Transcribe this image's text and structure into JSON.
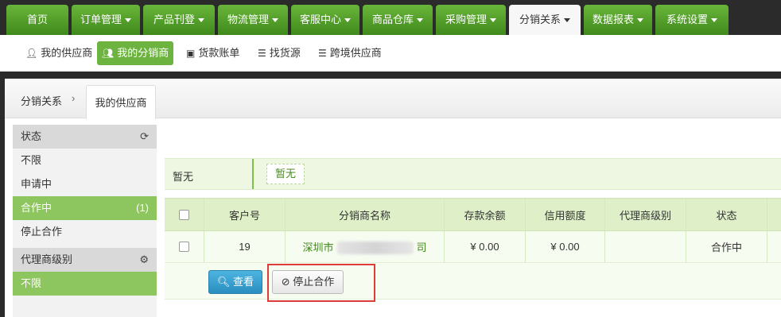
{
  "nav": {
    "tabs": [
      {
        "label": "首页"
      },
      {
        "label": "订单管理"
      },
      {
        "label": "产品刊登"
      },
      {
        "label": "物流管理"
      },
      {
        "label": "客服中心"
      },
      {
        "label": "商品仓库"
      },
      {
        "label": "采购管理"
      },
      {
        "label": "分销关系"
      },
      {
        "label": "数据报表"
      },
      {
        "label": "系统设置"
      }
    ],
    "active": "分销关系"
  },
  "subnav": {
    "items": [
      {
        "label": "我的供应商",
        "icon": "user-icon"
      },
      {
        "label": "我的分销商",
        "icon": "users-icon"
      },
      {
        "label": "货款账单",
        "icon": "money-icon"
      },
      {
        "label": "找货源",
        "icon": "list-icon"
      },
      {
        "label": "跨境供应商",
        "icon": "list-icon"
      }
    ],
    "active": "我的分销商"
  },
  "breadcrumb": {
    "root": "分销关系",
    "sep": "›",
    "current_tab": "我的供应商"
  },
  "filters": {
    "status_title": "状态",
    "status_items": [
      {
        "label": "不限"
      },
      {
        "label": "申请中"
      },
      {
        "label": "合作中",
        "count": "(1)"
      },
      {
        "label": "停止合作"
      }
    ],
    "level_title": "代理商级别",
    "level_items": [
      {
        "label": "不限"
      }
    ]
  },
  "summary": {
    "label": "暂无",
    "tag": "暂无"
  },
  "table": {
    "headers": [
      "客户号",
      "分销商名称",
      "存款余额",
      "信用额度",
      "代理商级别",
      "状态"
    ],
    "rows": [
      {
        "id": "19",
        "name_prefix": "深圳市",
        "name_suffix": "司",
        "balance": "¥ 0.00",
        "credit": "¥ 0.00",
        "level": "",
        "status": "合作中"
      }
    ]
  },
  "actions": {
    "view": "查看",
    "stop": "停止合作"
  },
  "colors": {
    "brand_green": "#5aa52c",
    "active_green": "#8dc55f",
    "highlight_red": "#e03b3b"
  }
}
